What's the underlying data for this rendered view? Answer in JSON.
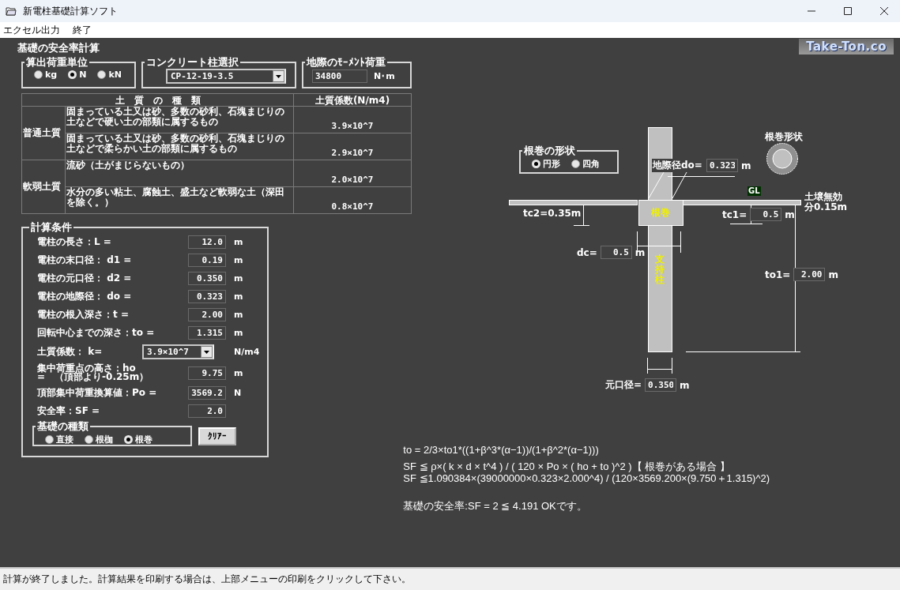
{
  "window": {
    "title": "新電柱基礎計算ソフト"
  },
  "menu": [
    "エクセル出力",
    "終了"
  ],
  "heading": "基礎の安全率計算",
  "logo": "Take-Ton.co",
  "unit_group": {
    "title": "算出荷重単位",
    "options": [
      {
        "label": "kg",
        "selected": false
      },
      {
        "label": "N",
        "selected": true
      },
      {
        "label": "kN",
        "selected": false
      }
    ]
  },
  "pole_group": {
    "title": "コンクリート柱選択",
    "value": "CP-12-19-3.5"
  },
  "moment_group": {
    "title": "地際のﾓｰﾒﾝﾄ荷重",
    "value": "34800",
    "unit": "N･m"
  },
  "soil_table": {
    "columns": [
      "土　質　の　種　類",
      "土質係数(N/m4)"
    ],
    "groups": [
      {
        "name": "普通土質",
        "rows": [
          {
            "description": "固まっている土又は砂、多数の砂利、石塊まじりの土などで硬い土の部類に属するもの",
            "coefficient": "3.9×10^7"
          },
          {
            "description": "固まっている土又は砂、多数の砂利、石塊まじりの土などで柔らかい土の部類に属するもの",
            "coefficient": "2.9×10^7"
          }
        ]
      },
      {
        "name": "軟弱土質",
        "rows": [
          {
            "description": "流砂（土がまじらないもの）",
            "coefficient": "2.0×10^7"
          },
          {
            "description": "水分の多い粘土、腐蝕土、盛土など軟弱な土（深田を除く。）",
            "coefficient": "0.8×10^7"
          }
        ]
      }
    ]
  },
  "calc": {
    "title": "計算条件",
    "fields": [
      {
        "kind": "input",
        "label": "電柱の長さ：L =",
        "value": "12.0",
        "unit": "m"
      },
      {
        "kind": "input",
        "label": "電柱の末口径： d1 =",
        "value": "0.19",
        "unit": "m"
      },
      {
        "kind": "input",
        "label": "電柱の元口径： d2 =",
        "value": "0.350",
        "unit": "m"
      },
      {
        "kind": "input",
        "label": "電柱の地際径： do =",
        "value": "0.323",
        "unit": "m"
      },
      {
        "kind": "input",
        "label": "電柱の根入深さ：t =",
        "value": "2.00",
        "unit": "m"
      },
      {
        "kind": "input",
        "label": "回転中心までの深さ：to =",
        "value": "1.315",
        "unit": "m"
      },
      {
        "kind": "select",
        "label": "土質係数： k=",
        "value": "3.9×10^7",
        "unit": "N/m4"
      },
      {
        "kind": "input",
        "label": "集中荷重点の高さ：ho\n=　（頂部より-0.25m）",
        "value": "9.75",
        "unit": "m"
      },
      {
        "kind": "input",
        "label": "頂部集中荷重換算値：Po =",
        "value": "3569.2",
        "unit": "N"
      },
      {
        "kind": "input",
        "label": "安全率：SF =",
        "value": "2.0"
      }
    ],
    "foundation": {
      "title": "基礎の種類",
      "options": [
        {
          "label": "直接",
          "selected": false
        },
        {
          "label": "根枷",
          "selected": false
        },
        {
          "label": "根巻",
          "selected": true
        }
      ]
    },
    "clear_button": "ｸﾘｱｰ"
  },
  "diagram": {
    "shape_group": {
      "title": "根巻の形状",
      "options": [
        {
          "label": "円形",
          "selected": true
        },
        {
          "label": "四角",
          "selected": false
        }
      ]
    },
    "shape_title": "根巻形状",
    "do_label": "地際径do=",
    "do_value": "0.323",
    "do_unit": "m",
    "gl": "GL",
    "soil_note": [
      "土壌無効",
      "分0.15m"
    ],
    "tc2": "tc2=0.35m",
    "collar": "根巻",
    "tc1_label": "tc1=",
    "tc1_value": "0.5",
    "tc1_unit": "m",
    "dc_label": "dc=",
    "dc_value": "0.5",
    "dc_unit": "m",
    "pole": "支持柱",
    "to1_label": "to1=",
    "to1_value": "2.00",
    "to1_unit": "m",
    "base_label": "元口径=",
    "base_value": "0.350",
    "base_unit": "m"
  },
  "formulas": [
    [
      "to = 2/3×to1*((1+β^3*(α−1))/(1+β^2*(α−1)))"
    ],
    [
      "SF ≦ ρ×( k × d × t^4 ) / ( 120 × Po × ( ho + to )^2 )【 根巻がある場合 】",
      "SF ≦1.090384×(39000000×0.323×2.000^4) / (120×3569.200×(9.750＋1.315)^2)"
    ]
  ],
  "result": "基礎の安全率:SF = 2 ≦ 4.191 OKです。",
  "status_bar": "計算が終了しました。計算結果を印刷する場合は、上部メニューの印刷をクリックして下さい。"
}
